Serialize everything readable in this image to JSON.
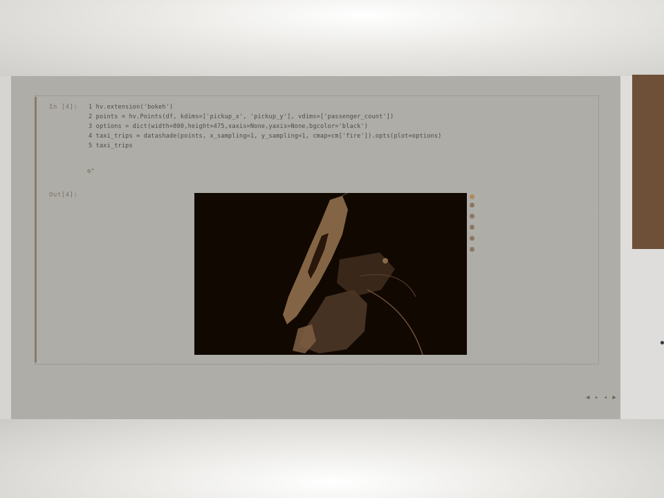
{
  "notebook": {
    "input_prompt": "In [4]:",
    "output_prompt": "Out[4]:",
    "code_lines": [
      "1 hv.extension('bokeh')",
      "2 points = hv.Points(df, kdims=['pickup_x', 'pickup_y'], vdims=['passenger_count'])",
      "3 options = dict(width=800,height=475,xaxis=None,yaxis=None,bgcolor='black')",
      "4 taxi_trips = datashade(points, x_sampling=1, y_sampling=1, cmap=cm['fire']).opts(plot=options)",
      "5 taxi_trips"
    ],
    "busy_indicator": "⚙°"
  },
  "plot": {
    "background": "#120802",
    "shade_color": "#8a6a4a",
    "toolbar_tools": [
      "pan-tool-icon",
      "wheel-zoom-icon",
      "box-zoom-icon",
      "reset-icon",
      "save-icon"
    ]
  },
  "slide_nav": {
    "label": "◀ ▸ ◂ ▶"
  },
  "colors": {
    "slide_bg": "#aeada8",
    "sidebar_accent": "#6e5038"
  }
}
